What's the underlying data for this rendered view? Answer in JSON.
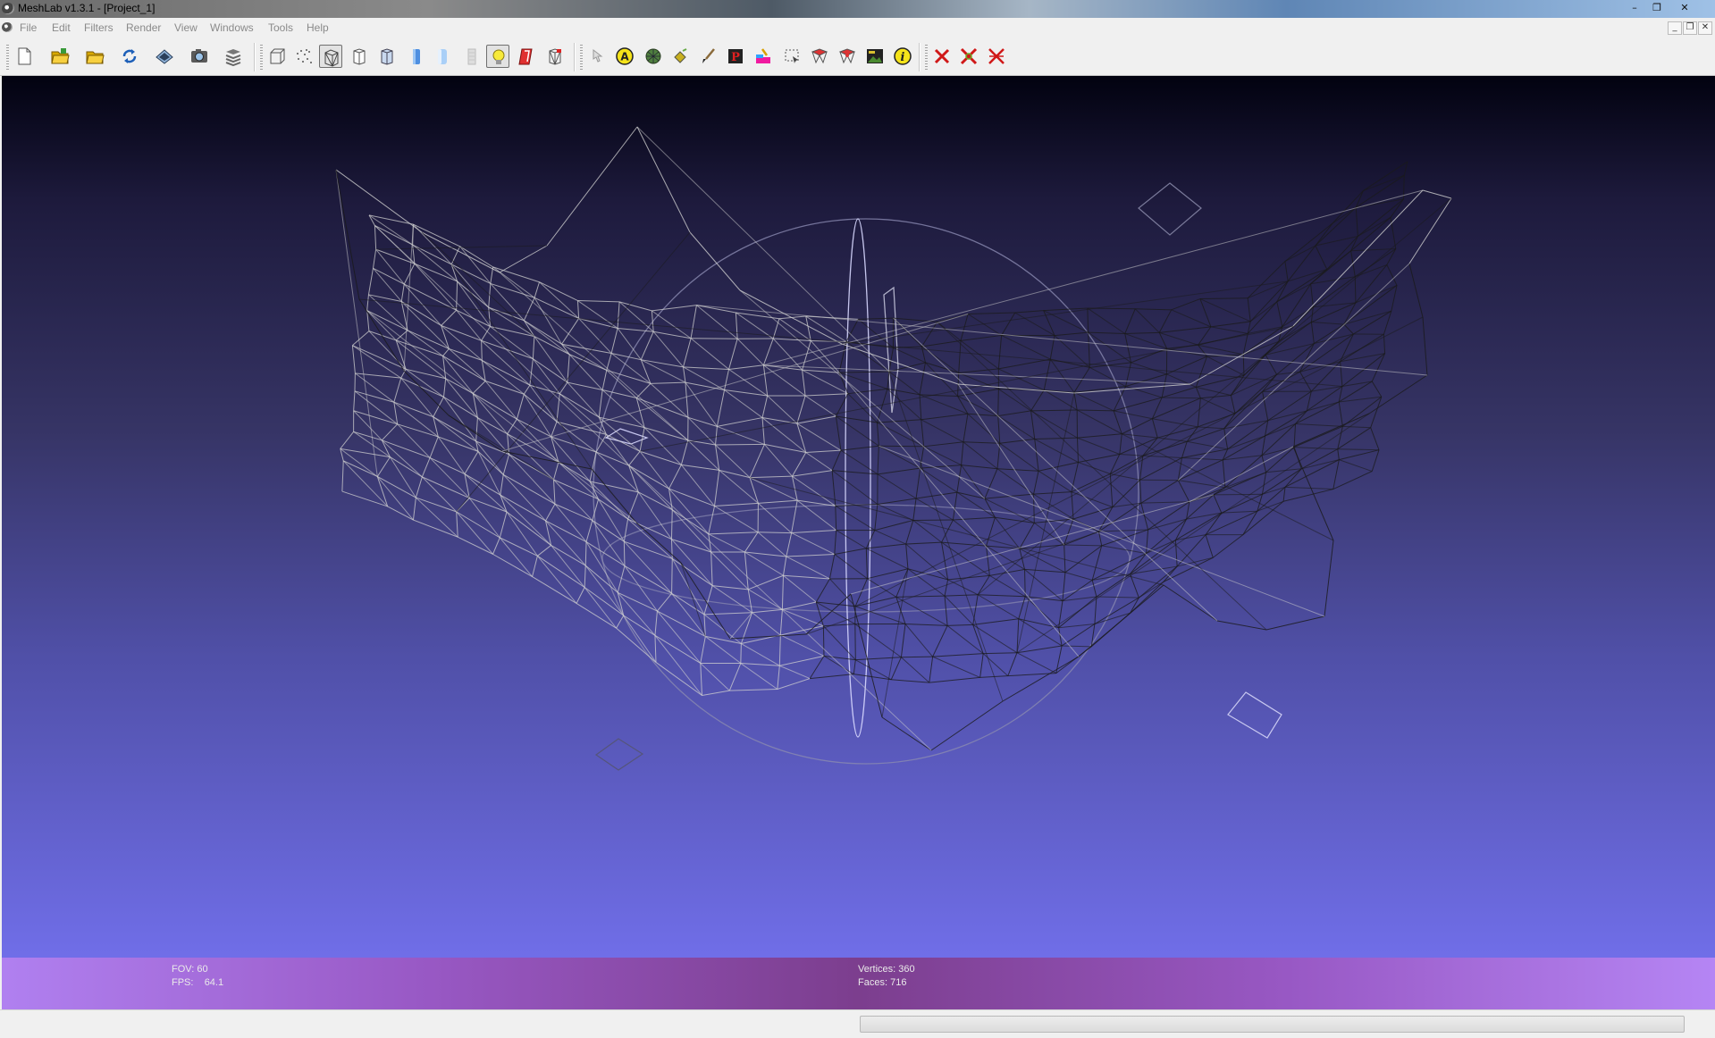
{
  "window": {
    "title": "MeshLab v1.3.1 - [Project_1]",
    "controls": [
      "–",
      "❐",
      "✕"
    ]
  },
  "menubar": {
    "items": [
      "File",
      "Edit",
      "Filters",
      "Render",
      "View",
      "Windows",
      "Tools",
      "Help"
    ],
    "mdi_controls": [
      "_",
      "❐",
      "✕"
    ]
  },
  "toolbar": {
    "groups": [
      [
        "new-project-icon",
        "open-project-icon",
        "import-mesh-icon",
        "reload-icon",
        "save-icon",
        "snapshot-icon",
        "layers-icon"
      ],
      [
        "bounding-box-icon",
        "points-icon",
        "wireframe-icon",
        "hidden-lines-icon",
        "flat-shading-icon",
        "smooth-shading-icon",
        "texture-icon",
        "lighting-icon",
        "backface-icon",
        "selected-faces-icon"
      ],
      [
        "pick-icon",
        "annotation-icon",
        "color-sphere-icon",
        "paint-bucket-icon",
        "paint-brush-icon",
        "align-icon",
        "color-paint-icon",
        "select-region-icon",
        "select-faces-icon",
        "select-vertices-icon",
        "raster-layer-icon",
        "info-icon"
      ],
      [
        "delete-faces-icon",
        "delete-vertices-icon",
        "delete-selected-icon"
      ]
    ],
    "pressed": [
      "wireframe-icon",
      "lighting-icon"
    ]
  },
  "viewport": {
    "fov_label": "FOV:",
    "fov_value": "60",
    "fps_label": "FPS:",
    "fps_value": "64.1",
    "vertices_label": "Vertices:",
    "vertices_value": "360",
    "faces_label": "Faces:",
    "faces_value": "716"
  },
  "colors": {
    "bg_top": "#020210",
    "bg_bottom": "#706ee8",
    "info_bar": "#9858c4",
    "mesh_dark": "#1a1a1a",
    "mesh_light": "#d0d0d0"
  }
}
